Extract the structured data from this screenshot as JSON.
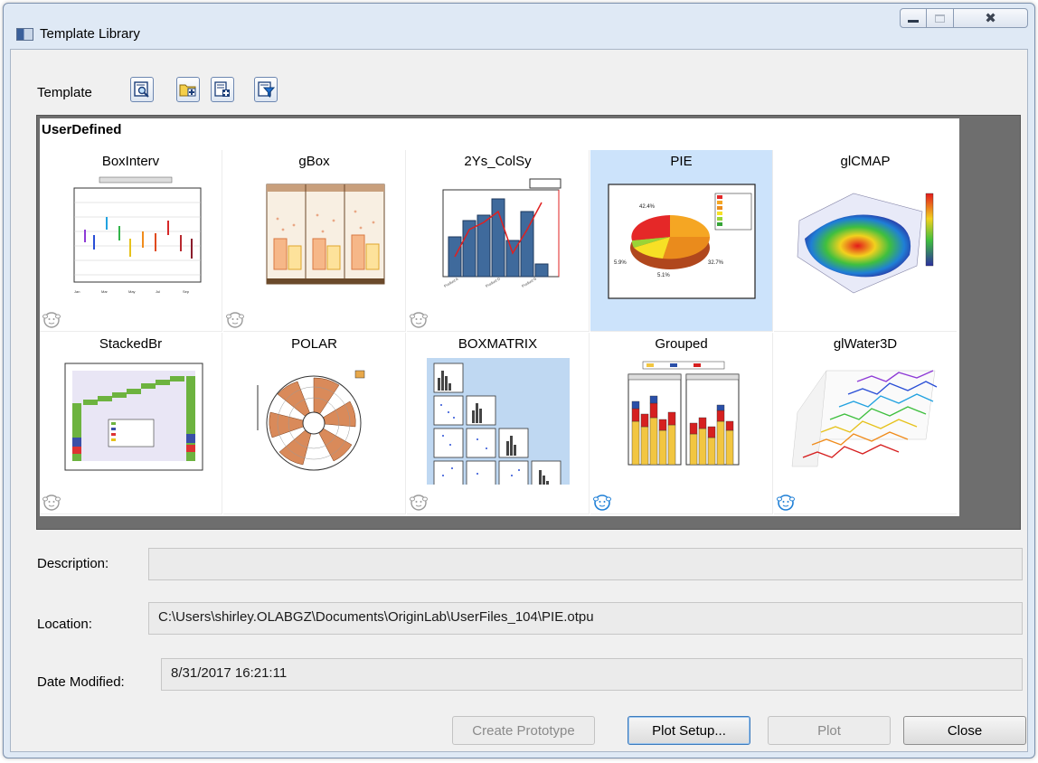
{
  "window": {
    "title": "Template Library",
    "close_glyph": "✖"
  },
  "toolbar": {
    "label": "Template",
    "icons": [
      "preview-icon",
      "new-folder-icon",
      "add-template-icon",
      "filter-icon"
    ]
  },
  "gallery": {
    "group_title": "UserDefined",
    "selected": "PIE",
    "rows": [
      [
        {
          "name": "BoxInterv",
          "sheep_color": "gray"
        },
        {
          "name": "gBox",
          "sheep_color": "gray"
        },
        {
          "name": "2Ys_ColSy",
          "sheep_color": "gray"
        },
        {
          "name": "PIE",
          "sheep_color": "none"
        },
        {
          "name": "glCMAP",
          "sheep_color": "none"
        }
      ],
      [
        {
          "name": "StackedBr",
          "sheep_color": "gray"
        },
        {
          "name": "POLAR",
          "sheep_color": "none"
        },
        {
          "name": "BOXMATRIX",
          "sheep_color": "gray"
        },
        {
          "name": "Grouped",
          "sheep_color": "blue"
        },
        {
          "name": "glWater3D",
          "sheep_color": "blue"
        }
      ]
    ]
  },
  "fields": {
    "description_label": "Description:",
    "description_value": "",
    "location_label": "Location:",
    "location_value": "C:\\Users\\shirley.OLABGZ\\Documents\\OriginLab\\UserFiles_104\\PIE.otpu",
    "date_label": "Date Modified:",
    "date_value": "8/31/2017 16:21:11"
  },
  "buttons": {
    "create_prototype": "Create Prototype",
    "plot_setup": "Plot Setup...",
    "plot": "Plot",
    "close": "Close"
  },
  "colors": {
    "selection": "#cce3fb",
    "frame": "#6e6e6e",
    "sheep_blue": "#1f7fd6",
    "sheep_gray": "#9a9a9a"
  }
}
